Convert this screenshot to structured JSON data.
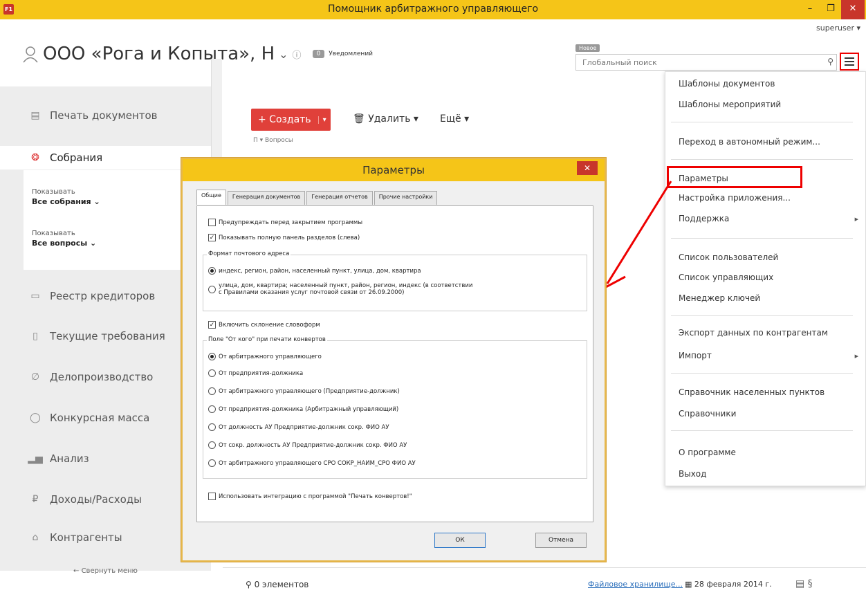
{
  "window": {
    "title": "Помощник арбитражного управляющего",
    "app_icon": "F1",
    "min": "–",
    "max": "❐",
    "close": "✕"
  },
  "header": {
    "user": "superuser ▾",
    "org_name": "ООО «Рога и Копыта», Н",
    "org_caret": "⌄",
    "info": "ⓘ",
    "notif_count": "0",
    "notif_label": "Уведомлений",
    "new_tag": "Новое",
    "search_placeholder": "Глобальный поиск",
    "search_icon": "⚲"
  },
  "sidebar": {
    "items": [
      {
        "label": "Печать документов",
        "icon": "document-icon"
      },
      {
        "label": "Собрания",
        "icon": "meeting-icon"
      },
      {
        "label": "Реестр кредиторов",
        "icon": "registry-icon"
      },
      {
        "label": "Текущие требования",
        "icon": "claims-icon"
      },
      {
        "label": "Делопроизводство",
        "icon": "clip-icon"
      },
      {
        "label": "Конкурсная масса",
        "icon": "mass-icon"
      },
      {
        "label": "Анализ",
        "icon": "chart-icon"
      },
      {
        "label": "Доходы/Расходы",
        "icon": "money-icon"
      },
      {
        "label": "Контрагенты",
        "icon": "bank-icon"
      }
    ],
    "filter1_label": "Показывать",
    "filter1_value": "Все собрания ⌄",
    "filter2_label": "Показывать",
    "filter2_value": "Все вопросы ⌄",
    "collapse": "←  Свернуть меню"
  },
  "toolbar": {
    "create": "+ Создать",
    "create_caret": "▾",
    "delete": "🗑 Удалить ▾",
    "more": "Ещё ▾",
    "crumbs": "П ▾   Вопросы"
  },
  "statusbar": {
    "count": "⚲  0 элементов",
    "file_store": "Файловое хранилище...",
    "date": "▦ 28 февраля 2014 г.",
    "icons": "▤   §"
  },
  "menu": {
    "items": [
      "Шаблоны документов",
      "Шаблоны мероприятий",
      "Переход в автономный режим...",
      "Параметры",
      "Настройка приложения...",
      "Поддержка",
      "Список пользователей",
      "Список управляющих",
      "Менеджер ключей",
      "Экспорт данных по контрагентам",
      "Импорт",
      "Справочник населенных пунктов",
      "Справочники",
      "О программе",
      "Выход"
    ]
  },
  "dialog": {
    "title": "Параметры",
    "close": "✕",
    "tabs": [
      "Общие",
      "Генерация документов",
      "Генерация отчетов",
      "Прочие настройки"
    ],
    "cb_warn": "Предупреждать перед закрытием программы",
    "cb_panel": "Показывать полную панель разделов (слева)",
    "addr_group": "Формат почтового адреса",
    "addr_opt1": "индекс, регион, район, населенный пункт, улица, дом, квартира",
    "addr_opt2a": "улица, дом, квартира; населенный пункт, район, регион, индекс (в соответствии",
    "addr_opt2b": "с Правилами оказания услуг почтовой связи от 26.09.2000)",
    "cb_decl": "Включить склонение словоформ",
    "from_group": "Поле \"От кого\" при печати конвертов",
    "from_opts": [
      "От арбитражного управляющего",
      "От предприятия-должника",
      "От арбитражного управляющего (Предприятие-должник)",
      "От предприятия-должника (Арбитражный управляющий)",
      "От должность АУ Предприятие-должник сокр. ФИО АУ",
      "От сокр. должность АУ Предприятие-должник сокр. ФИО АУ",
      "От арбитражного управляющего СРО СОКР_НАИМ_СРО ФИО АУ"
    ],
    "cb_envelopes": "Использовать интеграцию с программой \"Печать конвертов!\"",
    "ok": "ОК",
    "cancel": "Отмена"
  }
}
